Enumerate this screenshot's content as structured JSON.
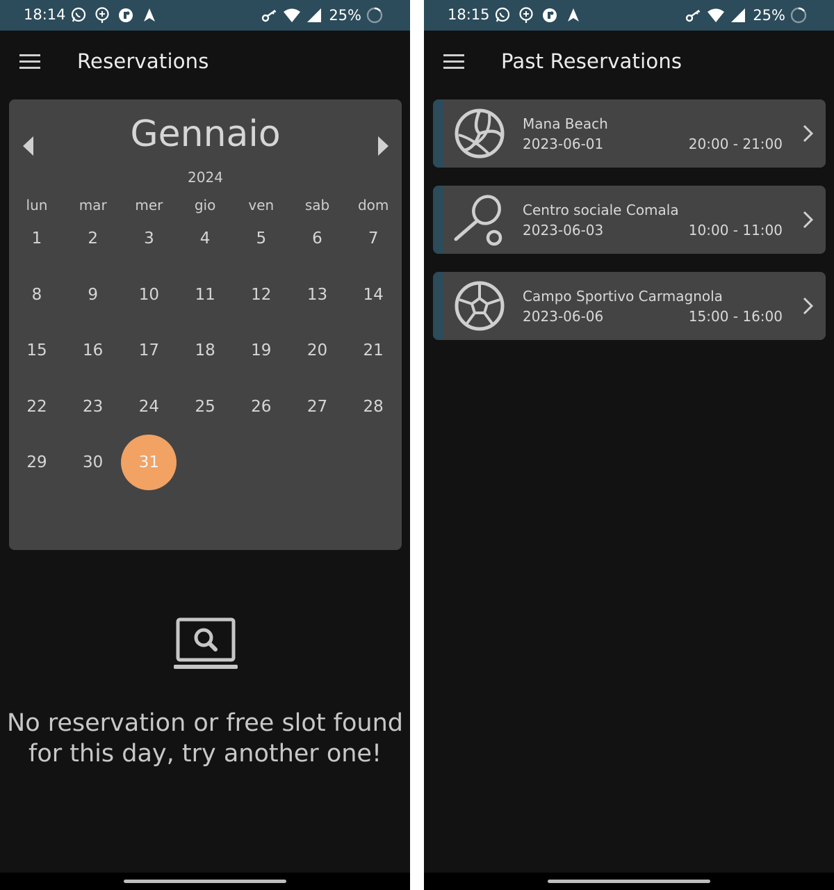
{
  "colors": {
    "status_bar": "#2c4b5b",
    "background": "#121212",
    "card": "#444444",
    "selected_day": "#f2a263",
    "accent_stripe": "#2c4b5b"
  },
  "left_screen": {
    "status_bar": {
      "time": "18:14",
      "battery": "25%",
      "icons_left": [
        "whatsapp-icon",
        "location-add-icon",
        "authenticator-icon",
        "navigation-icon"
      ],
      "icons_right": [
        "vpn-key-icon",
        "wifi-icon",
        "signal-icon",
        "battery-circle-icon"
      ]
    },
    "app_bar": {
      "title": "Reservations",
      "menu_icon": "menu-icon"
    },
    "calendar": {
      "month": "Gennaio",
      "year": "2024",
      "weekdays": [
        "lun",
        "mar",
        "mer",
        "gio",
        "ven",
        "sab",
        "dom"
      ],
      "days": [
        "1",
        "2",
        "3",
        "4",
        "5",
        "6",
        "7",
        "8",
        "9",
        "10",
        "11",
        "12",
        "13",
        "14",
        "15",
        "16",
        "17",
        "18",
        "19",
        "20",
        "21",
        "22",
        "23",
        "24",
        "25",
        "26",
        "27",
        "28",
        "29",
        "30",
        "31"
      ],
      "selected_day": "31"
    },
    "empty_state": {
      "icon": "laptop-search-icon",
      "line1": "No reservation or free slot found",
      "line2": "for this day, try another one!"
    }
  },
  "right_screen": {
    "status_bar": {
      "time": "18:15",
      "battery": "25%",
      "icons_left": [
        "whatsapp-icon",
        "location-add-icon",
        "authenticator-icon",
        "navigation-icon"
      ],
      "icons_right": [
        "vpn-key-icon",
        "wifi-icon",
        "signal-icon",
        "battery-circle-icon"
      ]
    },
    "app_bar": {
      "title": "Past Reservations",
      "menu_icon": "menu-icon"
    },
    "reservations": [
      {
        "name": "Mana Beach",
        "date": "2023-06-01",
        "time": "20:00 - 21:00",
        "icon": "volleyball-icon"
      },
      {
        "name": "Centro sociale Comala",
        "date": "2023-06-03",
        "time": "10:00 - 11:00",
        "icon": "tennis-racket-icon"
      },
      {
        "name": "Campo Sportivo Carmagnola",
        "date": "2023-06-06",
        "time": "15:00 - 16:00",
        "icon": "soccer-ball-icon"
      }
    ]
  }
}
